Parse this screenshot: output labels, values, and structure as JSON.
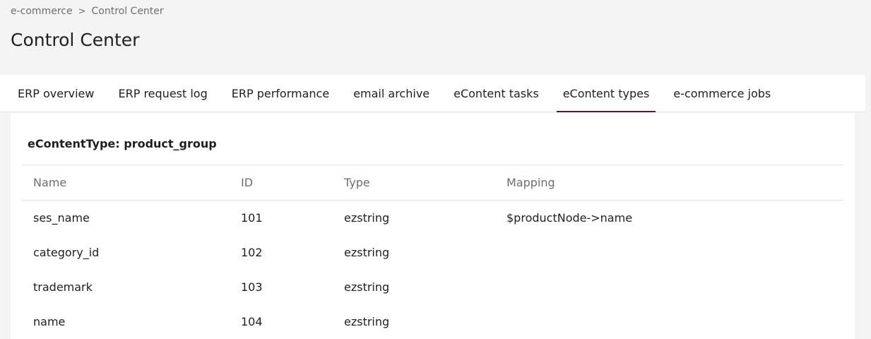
{
  "breadcrumb": {
    "items": [
      "e-commerce",
      "Control Center"
    ],
    "separator": ">"
  },
  "page": {
    "title": "Control Center"
  },
  "tabs": [
    {
      "label": "ERP overview",
      "active": false
    },
    {
      "label": "ERP request log",
      "active": false
    },
    {
      "label": "ERP performance",
      "active": false
    },
    {
      "label": "email archive",
      "active": false
    },
    {
      "label": "eContent tasks",
      "active": false
    },
    {
      "label": "eContent types",
      "active": true
    },
    {
      "label": "e-commerce jobs",
      "active": false
    }
  ],
  "panel": {
    "title": "eContentType: product_group",
    "columns": [
      "Name",
      "ID",
      "Type",
      "Mapping"
    ],
    "rows": [
      [
        "ses_name",
        "101",
        "ezstring",
        "$productNode->name"
      ],
      [
        "category_id",
        "102",
        "ezstring",
        ""
      ],
      [
        "trademark",
        "103",
        "ezstring",
        ""
      ],
      [
        "name",
        "104",
        "ezstring",
        ""
      ]
    ]
  },
  "colors": {
    "background": "#f4f4f4",
    "active_tab_underline": "#4b1c4a",
    "muted_text": "#6e6e6e"
  }
}
